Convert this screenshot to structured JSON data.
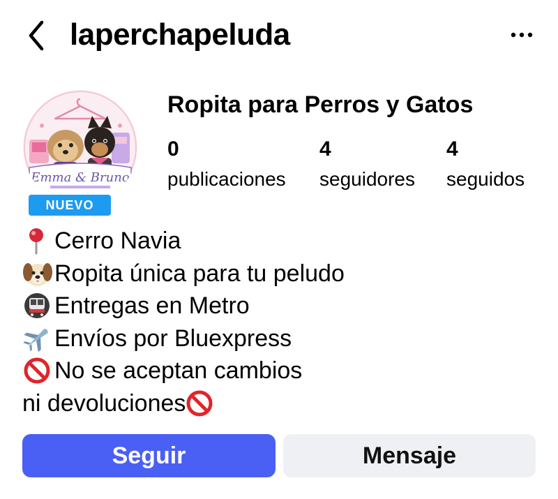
{
  "header": {
    "username": "laperchapeluda",
    "back_icon": "chevron-left-icon",
    "more_icon": "more-horizontal-icon"
  },
  "profile": {
    "avatar_icon": "profile-avatar-logo",
    "avatar_logo_text": "Emma & Bruno",
    "new_badge": "NUEVO",
    "display_name": "Ropita para Perros y Gatos",
    "stats": {
      "posts_count": "0",
      "posts_label": "publicaciones",
      "followers_count": "4",
      "followers_label": "seguidores",
      "following_count": "4",
      "following_label": "seguidos"
    }
  },
  "bio": {
    "lines": [
      {
        "icon": "round-pushpin-icon",
        "text": "Cerro Navia"
      },
      {
        "icon": "dog-face-icon",
        "text": "Ropita única para tu peludo"
      },
      {
        "icon": "metro-icon",
        "text": "Entregas en Metro"
      },
      {
        "icon": "airplane-icon",
        "text": "Envíos por Bluexpress"
      },
      {
        "icon": "prohibited-icon",
        "text": "No se aceptan cambios"
      },
      {
        "icon": "prohibited-icon",
        "text": "ni devoluciones"
      }
    ]
  },
  "actions": {
    "follow_label": "Seguir",
    "message_label": "Mensaje"
  },
  "colors": {
    "follow_button": "#4a5ff4",
    "message_button": "#eff0f3",
    "new_badge": "#1d9bf0",
    "prohibited": "#e0242b",
    "pin": "#d62839"
  }
}
